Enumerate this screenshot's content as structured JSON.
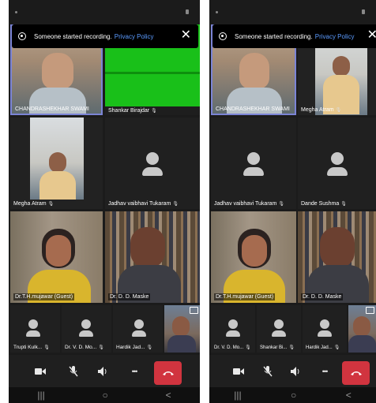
{
  "banner": {
    "message": "Someone started recording.",
    "link": "Privacy Policy",
    "close_glyph": "✕"
  },
  "left_screen": {
    "tiles": {
      "t1": "CHANDRASHEKHAR SWAMI",
      "t2": "Shankar Birajdar",
      "t3": "Megha Atram",
      "t4": "Jadhav vaibhavi Tukaram",
      "t5": "Dr.T.H.mujawar (Guest)",
      "t6": "Dr. D. D. Maske",
      "t7": "Trupti Kulk...",
      "t8": "Dr. V. D. Mo...",
      "t9": "Hardik Jad..."
    }
  },
  "right_screen": {
    "tiles": {
      "t1": "CHANDRASHEKHAR SWAMI",
      "t2": "Megha Atram",
      "t3": "Jadhav vaibhavi Tukaram",
      "t4": "Dande Sushma",
      "t5": "Dr.T.H.mujawar (Guest)",
      "t6": "Dr. D. D. Maske",
      "t7": "Dr. V. D. Mo...",
      "t8": "Shankar Bi...",
      "t9": "Hardik Jad..."
    }
  },
  "icons": {
    "mic_muted": "🎙",
    "more": "•••",
    "nav_recent": "|||",
    "nav_home": "○",
    "nav_back": "<"
  },
  "colors": {
    "active_speaker_border": "#7b84d6",
    "end_call": "#d1343f",
    "link": "#5b9bff"
  }
}
